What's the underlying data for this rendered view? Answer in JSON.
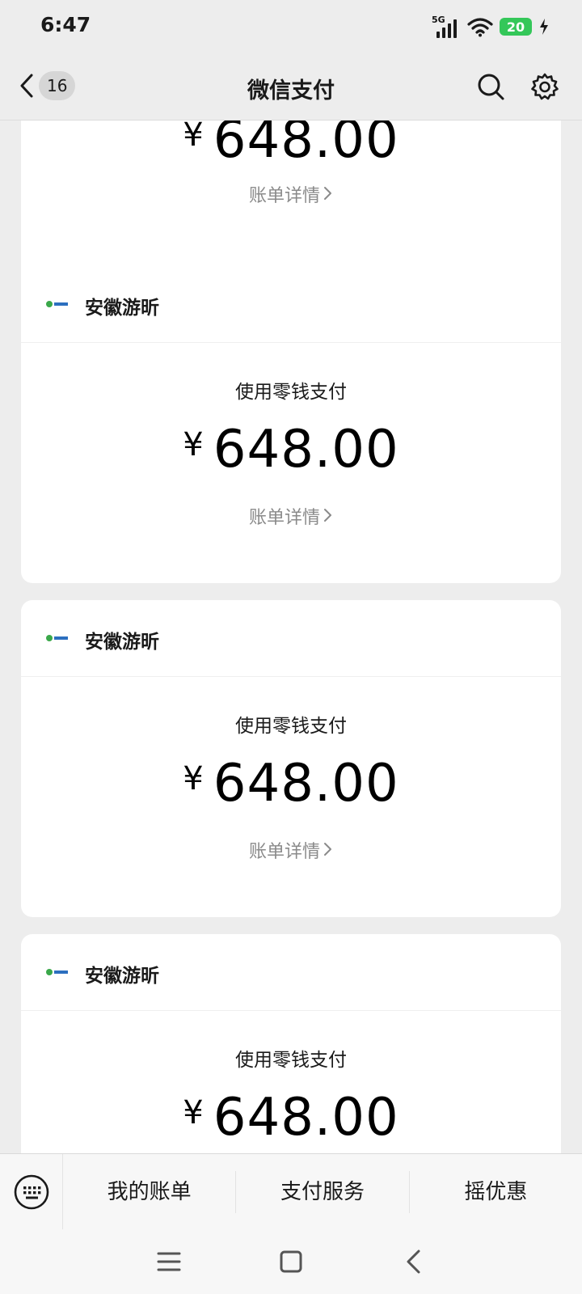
{
  "status_bar": {
    "time": "6:47",
    "network": "5G",
    "battery": "20"
  },
  "nav": {
    "back_count": "16",
    "title": "微信支付"
  },
  "cards": [
    {
      "amount_symbol": "¥",
      "amount": "648.00",
      "detail_label": "账单详情"
    },
    {
      "merchant": "安徽游昕",
      "payment_method": "使用零钱支付",
      "amount_symbol": "¥",
      "amount": "648.00",
      "detail_label": "账单详情"
    },
    {
      "merchant": "安徽游昕",
      "payment_method": "使用零钱支付",
      "amount_symbol": "¥",
      "amount": "648.00",
      "detail_label": "账单详情"
    },
    {
      "merchant": "安徽游昕",
      "payment_method": "使用零钱支付",
      "amount_symbol": "¥",
      "amount": "648.00"
    }
  ],
  "bottom_menu": {
    "items": [
      "我的账单",
      "支付服务",
      "摇优惠"
    ]
  },
  "colors": {
    "background": "#ededed",
    "card": "#ffffff",
    "battery": "#34c759",
    "muted_text": "#8a8a8a"
  },
  "icons": [
    "back-chevron-icon",
    "search-icon",
    "settings-gear-icon",
    "keyboard-icon",
    "merchant-logo-icon",
    "menu-icon",
    "home-square-icon",
    "back-icon"
  ]
}
